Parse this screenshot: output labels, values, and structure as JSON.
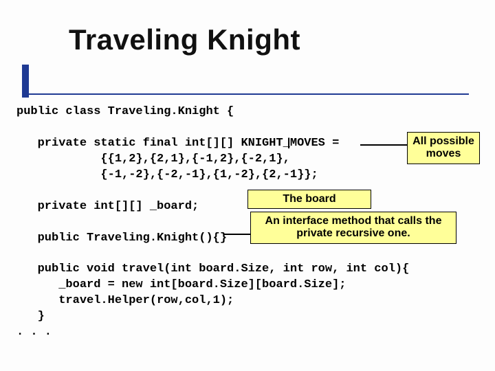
{
  "slide": {
    "title": "Traveling Knight"
  },
  "code": {
    "l1": "public class Traveling.Knight {",
    "l2": "",
    "l3": "   private static final int[][] KNIGHT_MOVES =",
    "l4": "            {{1,2},{2,1},{-1,2},{-2,1},",
    "l5": "            {-1,-2},{-2,-1},{1,-2},{2,-1}};",
    "l6": "",
    "l7": "   private int[][] _board;",
    "l8": "",
    "l9": "   public Traveling.Knight(){}",
    "l10": "",
    "l11": "   public void travel(int board.Size, int row, int col){",
    "l12": "      _board = new int[board.Size][board.Size];",
    "l13": "      travel.Helper(row,col,1);",
    "l14": "   }",
    "l15": ". . ."
  },
  "callouts": {
    "moves": "All possible moves",
    "board": "The board",
    "iface": "An interface method that calls the private recursive one."
  }
}
